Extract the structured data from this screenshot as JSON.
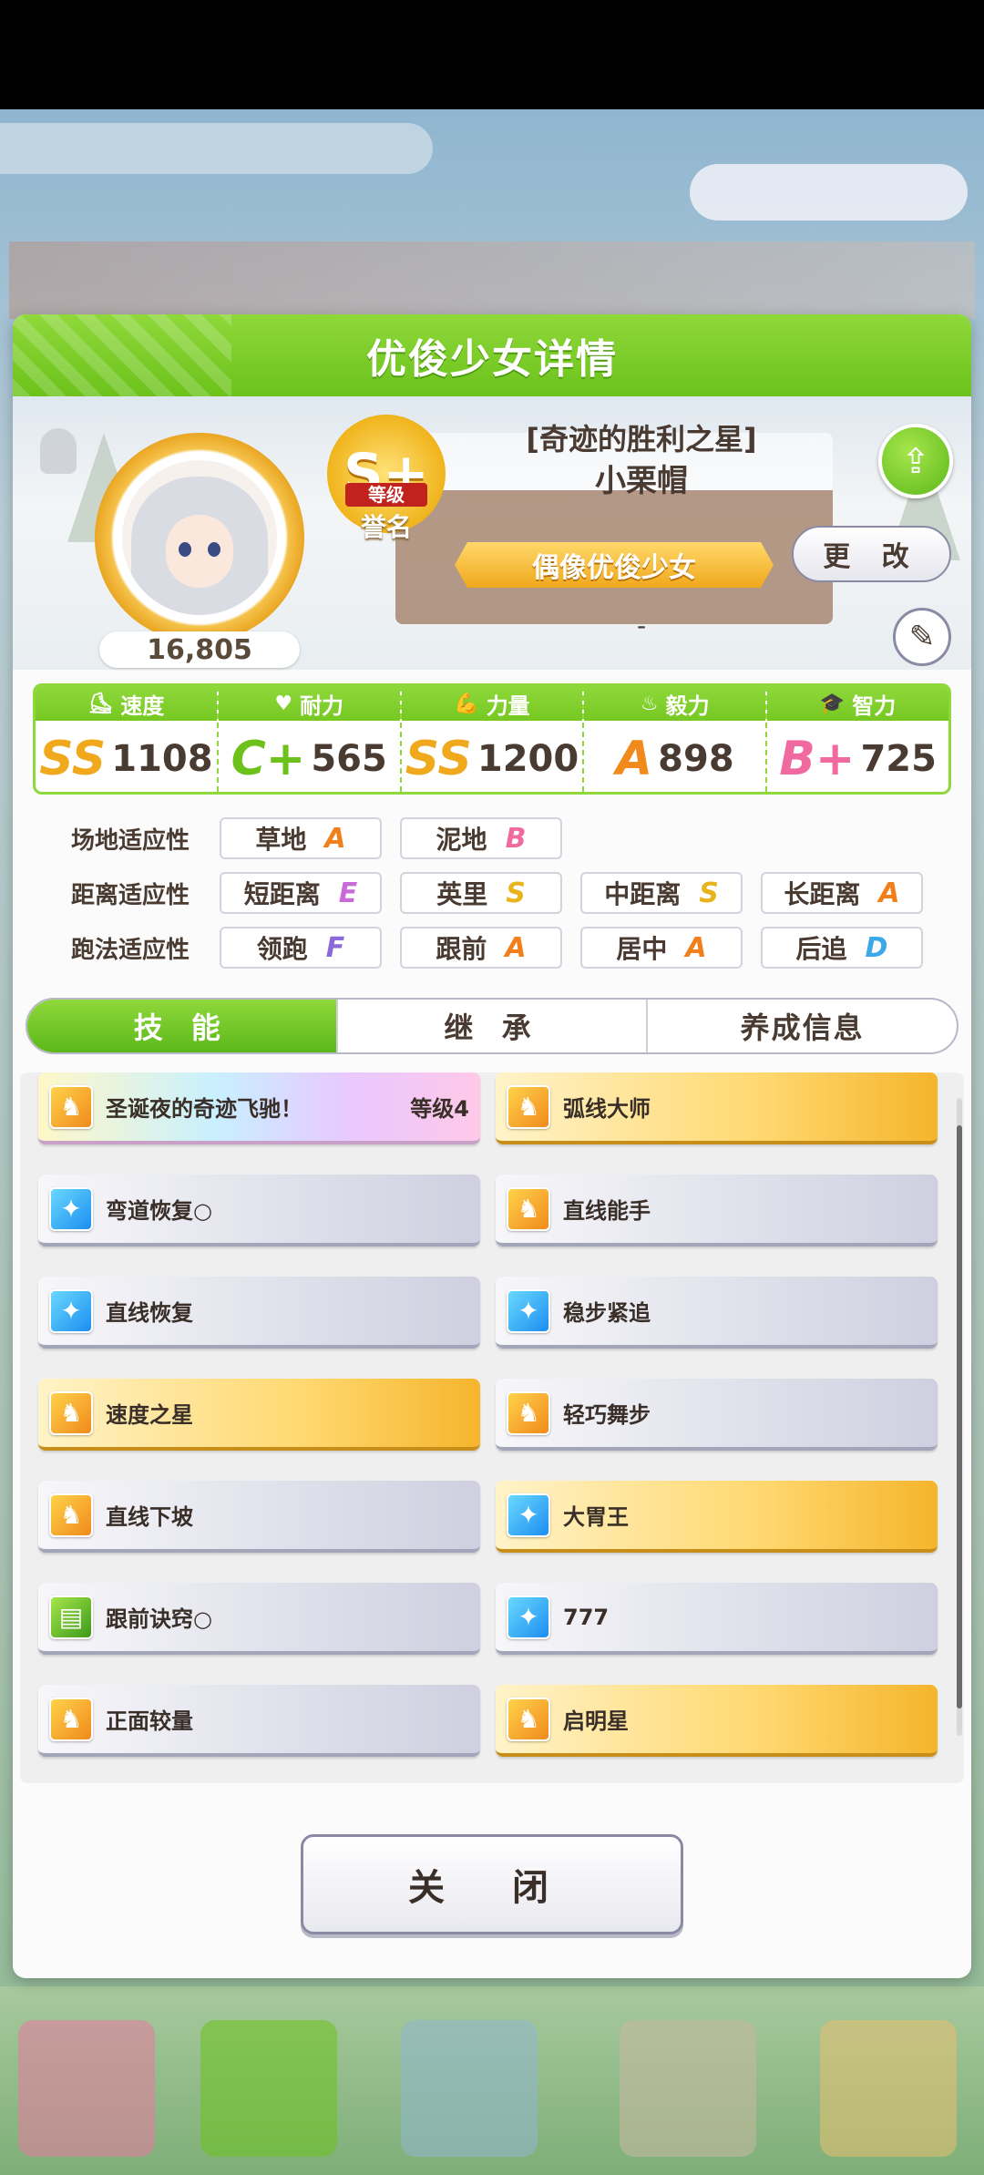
{
  "dialog": {
    "title": "优俊少女详情",
    "close_label": "关 闭"
  },
  "profile": {
    "fans": "16,805",
    "rank_letter": "S+",
    "rank_tag": "等级",
    "rank_label": "誉名",
    "title": "[奇迹的胜利之星]",
    "name": "小栗帽",
    "type": "偶像优俊少女",
    "sub": "-",
    "change_label": "更 改"
  },
  "stats": [
    {
      "label": "速度",
      "grade": "SS",
      "value": "1108",
      "color": "#f0a81c"
    },
    {
      "label": "耐力",
      "grade": "C+",
      "value": "565",
      "color": "#6cc21b"
    },
    {
      "label": "力量",
      "grade": "SS",
      "value": "1200",
      "color": "#f0a81c"
    },
    {
      "label": "毅力",
      "grade": "A",
      "value": "898",
      "color": "#f08a1c"
    },
    {
      "label": "智力",
      "grade": "B+",
      "value": "725",
      "color": "#f06aa0"
    }
  ],
  "aptitude": {
    "track": {
      "label": "场地适应性",
      "items": [
        {
          "name": "草地",
          "grade": "A"
        },
        {
          "name": "泥地",
          "grade": "B"
        }
      ]
    },
    "distance": {
      "label": "距离适应性",
      "items": [
        {
          "name": "短距离",
          "grade": "E"
        },
        {
          "name": "英里",
          "grade": "S"
        },
        {
          "name": "中距离",
          "grade": "S"
        },
        {
          "name": "长距离",
          "grade": "A"
        }
      ]
    },
    "style": {
      "label": "跑法适应性",
      "items": [
        {
          "name": "领跑",
          "grade": "F"
        },
        {
          "name": "跟前",
          "grade": "A"
        },
        {
          "name": "居中",
          "grade": "A"
        },
        {
          "name": "后追",
          "grade": "D"
        }
      ]
    }
  },
  "tabs": [
    "技 能",
    "继 承",
    "养成信息"
  ],
  "skills": [
    {
      "name": "圣诞夜的奇迹飞驰！",
      "level": "等级4",
      "style": "rainbow",
      "icon": "speed"
    },
    {
      "name": "弧线大师",
      "level": "",
      "style": "gold",
      "icon": "speed"
    },
    {
      "name": "弯道恢复○",
      "level": "",
      "style": "normal",
      "icon": "heal"
    },
    {
      "name": "直线能手",
      "level": "",
      "style": "normal",
      "icon": "speed"
    },
    {
      "name": "直线恢复",
      "level": "",
      "style": "normal",
      "icon": "heal"
    },
    {
      "name": "稳步紧追",
      "level": "",
      "style": "normal",
      "icon": "heal"
    },
    {
      "name": "速度之星",
      "level": "",
      "style": "gold",
      "icon": "speed"
    },
    {
      "name": "轻巧舞步",
      "level": "",
      "style": "normal",
      "icon": "speed"
    },
    {
      "name": "直线下坡",
      "level": "",
      "style": "normal",
      "icon": "speed"
    },
    {
      "name": "大胃王",
      "level": "",
      "style": "gold",
      "icon": "heal"
    },
    {
      "name": "跟前诀窍○",
      "level": "",
      "style": "normal",
      "icon": "book"
    },
    {
      "name": "777",
      "level": "",
      "style": "normal",
      "icon": "heal"
    },
    {
      "name": "正面较量",
      "level": "",
      "style": "normal",
      "icon": "speed"
    },
    {
      "name": "启明星",
      "level": "",
      "style": "gold",
      "icon": "speed"
    }
  ],
  "grade_colors": {
    "S": "#e8b41c",
    "A": "#f0801c",
    "B": "#f06aa0",
    "C": "#6cc21b",
    "D": "#3ca8e8",
    "E": "#c86ad8",
    "F": "#8a6ad8"
  }
}
